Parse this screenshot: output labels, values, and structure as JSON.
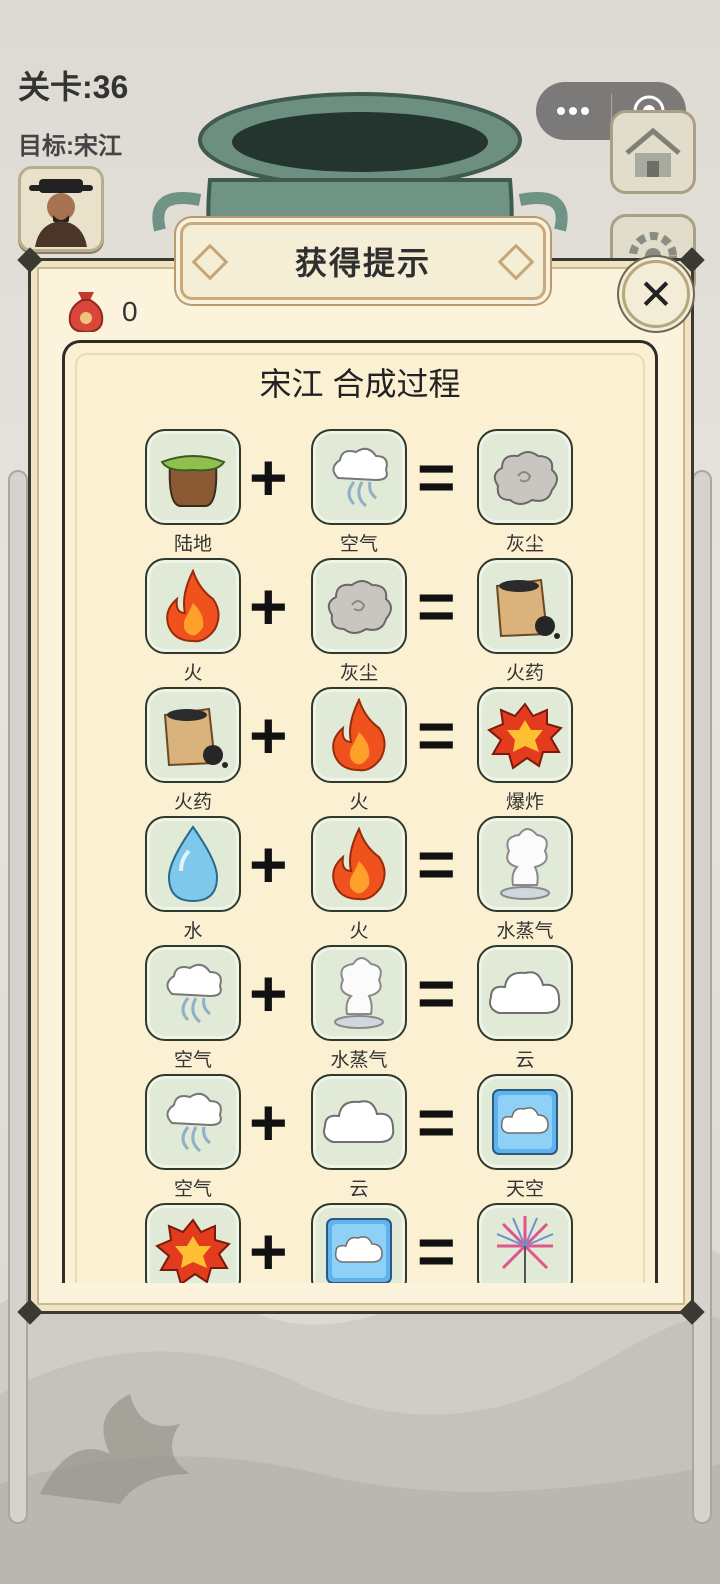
{
  "hud": {
    "level_label": "关卡:36",
    "target_label": "目标:宋江"
  },
  "modal": {
    "title": "获得提示",
    "close_glyph": "✕",
    "bag_count": "0",
    "process_title": "宋江 合成过程"
  },
  "recipes": [
    {
      "a": {
        "name": "陆地",
        "icon": "land-icon"
      },
      "b": {
        "name": "空气",
        "icon": "air-icon"
      },
      "result": {
        "name": "灰尘",
        "icon": "dust-icon"
      }
    },
    {
      "a": {
        "name": "火",
        "icon": "fire-icon"
      },
      "b": {
        "name": "灰尘",
        "icon": "dust-icon"
      },
      "result": {
        "name": "火药",
        "icon": "gunpowder-icon"
      }
    },
    {
      "a": {
        "name": "火药",
        "icon": "gunpowder-icon"
      },
      "b": {
        "name": "火",
        "icon": "fire-icon"
      },
      "result": {
        "name": "爆炸",
        "icon": "explosion-icon"
      }
    },
    {
      "a": {
        "name": "水",
        "icon": "water-icon"
      },
      "b": {
        "name": "火",
        "icon": "fire-icon"
      },
      "result": {
        "name": "水蒸气",
        "icon": "steam-icon"
      }
    },
    {
      "a": {
        "name": "空气",
        "icon": "air-icon"
      },
      "b": {
        "name": "水蒸气",
        "icon": "steam-icon"
      },
      "result": {
        "name": "云",
        "icon": "cloud-icon"
      }
    },
    {
      "a": {
        "name": "空气",
        "icon": "air-icon"
      },
      "b": {
        "name": "云",
        "icon": "cloud-icon"
      },
      "result": {
        "name": "天空",
        "icon": "sky-icon"
      }
    },
    {
      "a": {
        "name": "",
        "icon": "explosion-icon"
      },
      "b": {
        "name": "",
        "icon": "sky-icon"
      },
      "result": {
        "name": "",
        "icon": "firework-icon"
      }
    }
  ],
  "operators": {
    "plus": "+",
    "equals": "="
  }
}
